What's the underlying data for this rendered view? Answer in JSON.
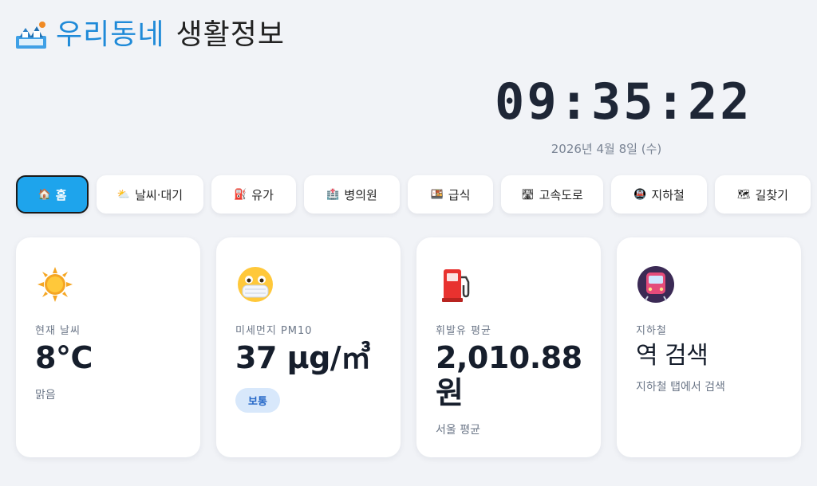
{
  "header": {
    "title_highlight": "우리동네",
    "title_rest": "생활정보",
    "icon": "house-map-icon"
  },
  "clock": {
    "time": "09:35:22",
    "date": "2026년 4월 8일 (수)"
  },
  "tabs": [
    {
      "icon": "🏠",
      "icon_name": "home-icon",
      "label": "홈",
      "active": true
    },
    {
      "icon": "⛅",
      "icon_name": "weather-icon",
      "label": "날씨·대기",
      "active": false
    },
    {
      "icon": "⛽",
      "icon_name": "fuel-icon",
      "label": "유가",
      "active": false
    },
    {
      "icon": "🏥",
      "icon_name": "hospital-icon",
      "label": "병의원",
      "active": false
    },
    {
      "icon": "🍱",
      "icon_name": "meal-icon",
      "label": "급식",
      "active": false
    },
    {
      "icon": "🛣",
      "icon_name": "highway-icon",
      "label": "고속도로",
      "active": false
    },
    {
      "icon": "🚇",
      "icon_name": "subway-icon",
      "label": "지하철",
      "active": false
    },
    {
      "icon": "🗺",
      "icon_name": "map-icon",
      "label": "길찾기",
      "active": false
    }
  ],
  "cards": {
    "weather": {
      "icon": "sun-icon",
      "label": "현재 날씨",
      "value": "8°C",
      "sub": "맑음"
    },
    "dust": {
      "icon": "mask-face-icon",
      "label": "미세먼지 PM10",
      "value": "37 μg/㎥",
      "badge": "보통"
    },
    "fuel": {
      "icon": "fuel-pump-icon",
      "label": "휘발유 평균",
      "value": "2,010.88",
      "value_unit": "원",
      "sub": "서울 평균"
    },
    "subway": {
      "icon": "metro-icon",
      "label": "지하철",
      "value": "역 검색",
      "sub": "지하철 탭에서 검색"
    }
  },
  "colors": {
    "accent": "#1ea4ec",
    "brand_blue": "#1f8ad8",
    "background": "#f1f3f7",
    "badge_bg": "#d8e8fb",
    "badge_text": "#2668c8"
  }
}
